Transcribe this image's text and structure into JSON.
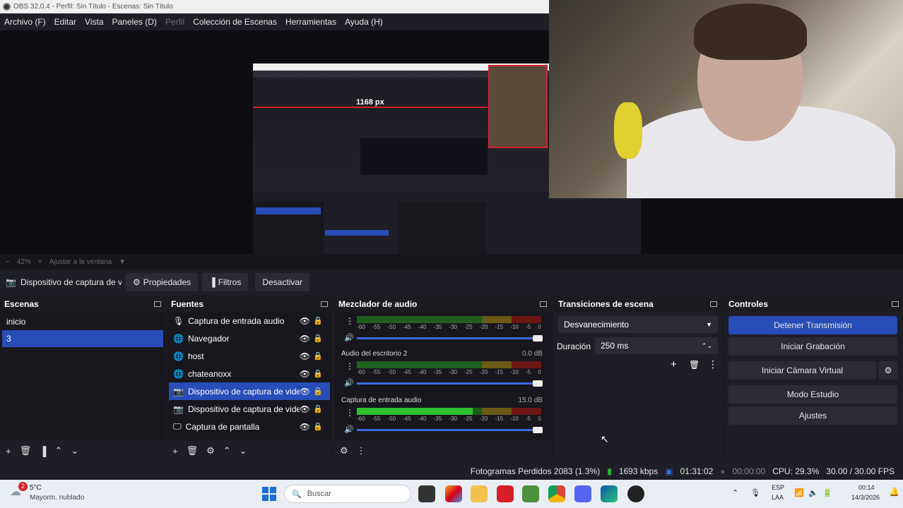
{
  "titlebar": {
    "title": "OBS 32.0.4 - Perfil: Sin Título - Escenas: Sin Título"
  },
  "menu": {
    "items": [
      "Archivo (F)",
      "Editar",
      "Vista",
      "Paneles (D)",
      "Perfil",
      "Colección de Escenas",
      "Herramientas",
      "Ayuda (H)"
    ]
  },
  "preview": {
    "px_label": "1168 px"
  },
  "zoom": {
    "value": "42%",
    "fit_label": "Ajustar a la ventana"
  },
  "source_toolbar": {
    "source_name": "Dispositivo de captura de v",
    "properties": "Propiedades",
    "filters": "Filtros",
    "deactivate": "Desactivar"
  },
  "scenes": {
    "title": "Escenas",
    "items": [
      "inicio",
      "3"
    ],
    "selected_index": 1
  },
  "sources": {
    "title": "Fuentes",
    "items": [
      {
        "label": "Captura de entrada audio",
        "icon": "mic-icon"
      },
      {
        "label": "Navegador",
        "icon": "globe-icon"
      },
      {
        "label": "host",
        "icon": "globe-icon"
      },
      {
        "label": "chateanoxx",
        "icon": "globe-icon"
      },
      {
        "label": "Dispositivo de captura de video",
        "icon": "camera-icon"
      },
      {
        "label": "Dispositivo de captura de video",
        "icon": "camera-icon"
      },
      {
        "label": "Captura de pantalla",
        "icon": "monitor-icon"
      }
    ],
    "selected_index": 4
  },
  "mixer": {
    "title": "Mezclador de audio",
    "ticks": [
      "-60",
      "-55",
      "-50",
      "-45",
      "-40",
      "-35",
      "-30",
      "-25",
      "-20",
      "-15",
      "-10",
      "-5",
      "0"
    ],
    "channels": [
      {
        "name": "",
        "db": "",
        "level": 0
      },
      {
        "name": "Audio del escritorio 2",
        "db": "0.0 dB",
        "level": 0
      },
      {
        "name": "Captura de entrada audio",
        "db": "15.0 dB",
        "level": 0.63
      }
    ]
  },
  "transitions": {
    "title": "Transiciones de escena",
    "selected": "Desvanecimiento",
    "duration_label": "Duración",
    "duration_value": "250 ms"
  },
  "controls": {
    "title": "Controles",
    "buttons": [
      "Detener Transmisión",
      "Iniciar Grabación",
      "Iniciar Cámara Virtual",
      "Modo Estudio",
      "Ajustes"
    ]
  },
  "status": {
    "dropped": "Fotogramas Perdidos 2083 (1.3%)",
    "bitrate": "1693 kbps",
    "stream_time": "01:31:02",
    "rec_time": "00:00:00",
    "cpu": "CPU: 29.3%",
    "fps": "30.00 / 30.00 FPS"
  },
  "taskbar": {
    "weather_temp": "5°C",
    "weather_desc": "Mayorm. nublado",
    "search_placeholder": "Buscar",
    "lang1": "ESP",
    "lang2": "LAA",
    "time": "00:14",
    "date": "14/3/2026",
    "badge": "2"
  },
  "colors": {
    "accent": "#284cb8",
    "red": "#d71e2a",
    "meter_green": "#2ec02e"
  }
}
